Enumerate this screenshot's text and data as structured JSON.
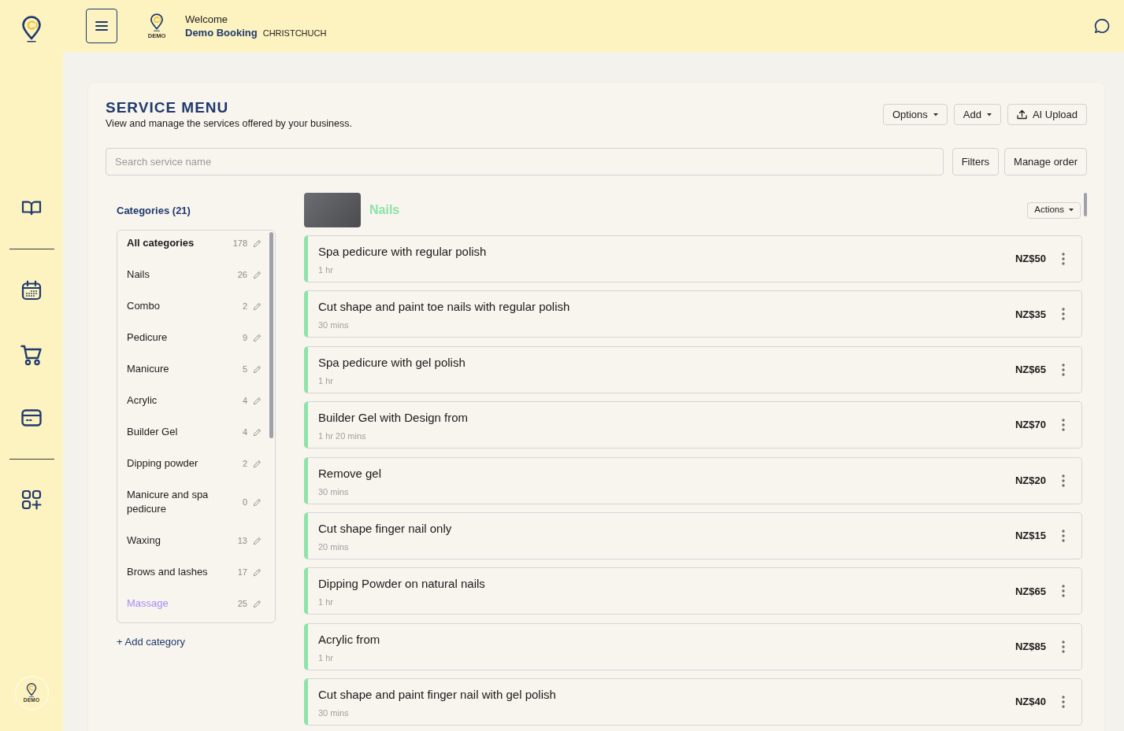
{
  "sidebar": {
    "account_caption": "DEMO"
  },
  "header": {
    "logo_caption": "DEMO",
    "greeting": "Welcome",
    "business_name": "Demo Booking",
    "location": "CHRISTCHUCH"
  },
  "page": {
    "title": "SERVICE MENU",
    "subtitle": "View and manage the services offered by your business.",
    "buttons": [
      {
        "label": "Options",
        "kind": "dropdown"
      },
      {
        "label": "Add",
        "kind": "dropdown"
      },
      {
        "label": "AI Upload",
        "kind": "upload"
      }
    ]
  },
  "search": {
    "placeholder": "Search service name",
    "buttons": [
      "Filters",
      "Manage order"
    ]
  },
  "categories": {
    "heading": "Categories (21)",
    "items": [
      {
        "name": "All categories",
        "count": "178",
        "selected": true,
        "hovered": false
      },
      {
        "name": "Nails",
        "count": "26",
        "selected": false,
        "hovered": false
      },
      {
        "name": "Combo",
        "count": "2",
        "selected": false,
        "hovered": false
      },
      {
        "name": "Pedicure",
        "count": "9",
        "selected": false,
        "hovered": false
      },
      {
        "name": "Manicure",
        "count": "5",
        "selected": false,
        "hovered": false
      },
      {
        "name": "Acrylic",
        "count": "4",
        "selected": false,
        "hovered": false
      },
      {
        "name": "Builder Gel",
        "count": "4",
        "selected": false,
        "hovered": false
      },
      {
        "name": "Dipping powder",
        "count": "2",
        "selected": false,
        "hovered": false
      },
      {
        "name": "Manicure and spa pedicure",
        "count": "0",
        "selected": false,
        "hovered": false
      },
      {
        "name": "Waxing",
        "count": "13",
        "selected": false,
        "hovered": false
      },
      {
        "name": "Brows and lashes",
        "count": "17",
        "selected": false,
        "hovered": false
      },
      {
        "name": "Massage",
        "count": "25",
        "selected": false,
        "hovered": true
      }
    ],
    "add_link": "+ Add category"
  },
  "category_panel": {
    "name": "Nails",
    "actions_button": "Actions",
    "services": [
      {
        "name": "Spa pedicure with regular polish",
        "duration": "1 hr",
        "price": "NZ$50"
      },
      {
        "name": "Cut shape and paint toe nails with regular polish",
        "duration": "30 mins",
        "price": "NZ$35"
      },
      {
        "name": "Spa pedicure with gel polish",
        "duration": "1 hr",
        "price": "NZ$65"
      },
      {
        "name": "Builder Gel with Design from",
        "duration": "1 hr 20 mins",
        "price": "NZ$70"
      },
      {
        "name": "Remove gel",
        "duration": "30 mins",
        "price": "NZ$20"
      },
      {
        "name": "Cut shape finger nail only",
        "duration": "20 mins",
        "price": "NZ$15"
      },
      {
        "name": "Dipping Powder on natural nails",
        "duration": "1 hr",
        "price": "NZ$65"
      },
      {
        "name": "Acrylic from",
        "duration": "1 hr",
        "price": "NZ$85"
      },
      {
        "name": "Cut shape and paint finger nail with gel polish",
        "duration": "30 mins",
        "price": "NZ$40"
      }
    ]
  }
}
